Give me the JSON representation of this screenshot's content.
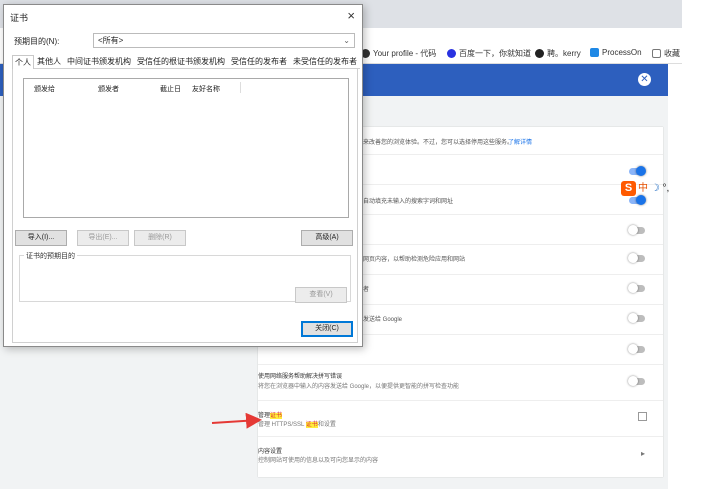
{
  "browser": {
    "bookmarks": [
      {
        "label": "Your profile - 代码",
        "icon": "github-icon",
        "color": "#333333"
      },
      {
        "label": "百度一下，你就知道",
        "icon": "baidu-paw-icon",
        "color": "#2932e1"
      },
      {
        "label": "聘。kerry",
        "icon": "circle-icon",
        "color": "#222222"
      },
      {
        "label": "ProcessOn",
        "icon": "processon-icon",
        "color": "#1e88e5"
      },
      {
        "label": "收藏",
        "icon": "page-icon",
        "color": "#777777"
      }
    ],
    "header_color": "#2d5fbe",
    "rows": [
      {
        "text": "来改善您的浏览体验。不过，您可以选择停用这些服务。",
        "link": "了解详情"
      },
      {
        "text": ""
      },
      {
        "text": "自动填充未输入的搜索字词和网址"
      },
      {
        "text": ""
      },
      {
        "text": "网页内容，以帮助检测危险应用和网站"
      },
      {
        "text": "者"
      },
      {
        "text": "发送给 Google"
      },
      {
        "text": ""
      },
      {
        "title": "使用网络服务帮助解决拼写错误",
        "desc": "将您在浏览器中输入的内容发送给 Google，以便提供更智能的拼写检查功能"
      },
      {
        "title_prefix": "管理",
        "title_highlight": "证书",
        "desc_prefix": "管理 HTTPS/SSL ",
        "desc_highlight": "证书",
        "desc_suffix": "和设置"
      },
      {
        "title": "内容设置",
        "desc": "控制网站可使用的信息以及可向您显示的内容"
      }
    ],
    "ime": {
      "label": "中",
      "extra": "°,"
    }
  },
  "dialog": {
    "title": "证书",
    "close": "×",
    "purpose_label": "预期目的(N):",
    "purpose_value": "<所有>",
    "tabs": [
      "个人",
      "其他人",
      "中间证书颁发机构",
      "受信任的根证书颁发机构",
      "受信任的发布者",
      "未受信任的发布者"
    ],
    "active_tab": 0,
    "columns": [
      "颁发给",
      "颁发者",
      "截止日",
      "友好名称"
    ],
    "buttons": {
      "import": "导入(I)...",
      "export": "导出(E)...",
      "remove": "删除(R)",
      "advanced": "高级(A)",
      "view": "查看(V)",
      "close": "关闭(C)"
    },
    "purposes_group_label": "证书的预期目的"
  },
  "colors": {
    "accent": "#0078d7",
    "arrow": "#e53935",
    "toggle_on": "#1a73e8"
  }
}
